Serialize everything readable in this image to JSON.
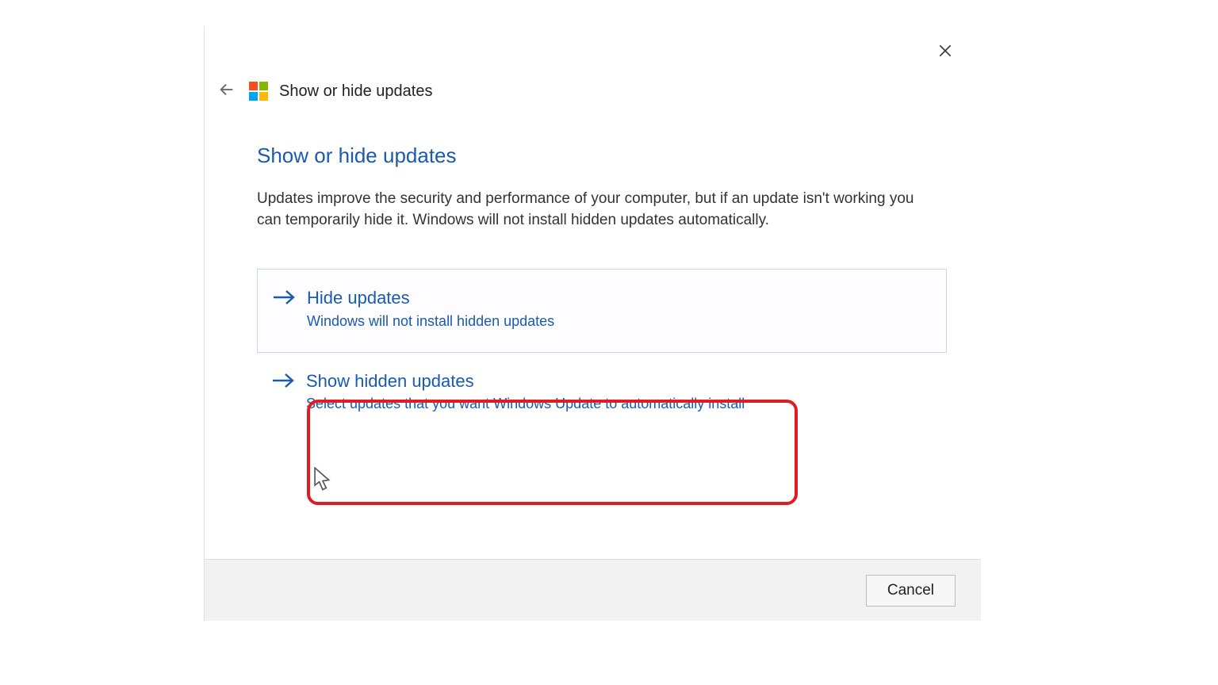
{
  "header": {
    "title": "Show or hide updates"
  },
  "content": {
    "heading": "Show or hide updates",
    "description": "Updates improve the security and performance of your computer, but if an update isn't working you can temporarily hide it. Windows will not install hidden updates automatically."
  },
  "options": [
    {
      "title": "Hide updates",
      "subtitle": "Windows will not install hidden updates"
    },
    {
      "title": "Show hidden updates",
      "subtitle": "Select updates that you want Windows Update to automatically install"
    }
  ],
  "footer": {
    "cancel": "Cancel"
  },
  "colors": {
    "link": "#1a5ab1",
    "highlight": "#e01b24"
  }
}
